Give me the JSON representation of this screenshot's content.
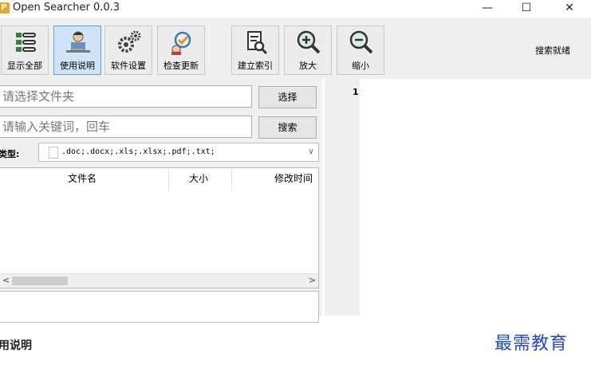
{
  "window": {
    "icon_letter": "P",
    "title": "Open Searcher 0.0.3",
    "minimize": "—",
    "maximize": "☐",
    "close": "✕"
  },
  "toolbar": {
    "buttons": [
      {
        "label": "显示全部",
        "icon": "list-icon",
        "active": false
      },
      {
        "label": "使用说明",
        "icon": "help-person-icon",
        "active": true
      },
      {
        "label": "软件设置",
        "icon": "gear-icon",
        "active": false
      },
      {
        "label": "检查更新",
        "icon": "update-icon",
        "active": false
      },
      {
        "label": "建立索引",
        "icon": "index-document-icon",
        "active": false
      },
      {
        "label": "放大",
        "icon": "zoom-in-icon",
        "active": false
      },
      {
        "label": "缩小",
        "icon": "zoom-out-icon",
        "active": false
      }
    ],
    "status_text": "搜索就绪"
  },
  "folder": {
    "placeholder": "请选择文件夹",
    "button": "选择"
  },
  "search": {
    "placeholder": "请输入关键词，回车",
    "button": "搜索"
  },
  "filter": {
    "label": "类型:",
    "value": ".doc;.docx;.xls;.xlsx;.pdf;.txt;"
  },
  "file_list": {
    "columns": [
      "文件名",
      "大小",
      "修改时间"
    ],
    "scroll_left": "<",
    "scroll_right": ">"
  },
  "viewer": {
    "line_number": "1"
  },
  "caption": "用说明",
  "watermark": "最需教育",
  "colors": {
    "accent": "#5aa0d8",
    "watermark": "#2348c8"
  }
}
